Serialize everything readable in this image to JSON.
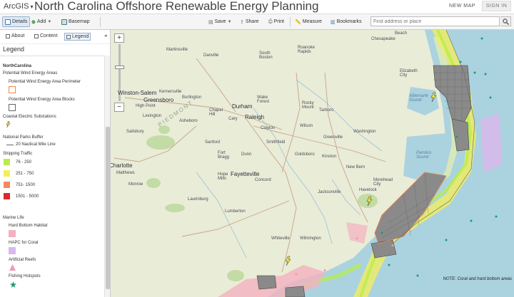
{
  "header": {
    "brand": "ArcGIS",
    "title": "North Carolina Offshore Renewable Energy Planning",
    "new_map": "NEW MAP",
    "sign_in": "SIGN IN"
  },
  "toolbar": {
    "details": "Details",
    "add": "Add",
    "basemap": "Basemap",
    "save": "Save",
    "share": "Share",
    "print": "Print",
    "measure": "Measure",
    "bookmarks": "Bookmarks",
    "search_placeholder": "Find address or place"
  },
  "sidepanel": {
    "tabs": {
      "about": "About",
      "content": "Content",
      "legend": "Legend"
    },
    "panel_title": "Legend",
    "legend": {
      "layer": "NorthCarolina",
      "wind_group": "Potential Wind Energy Areas",
      "wind_perimeter": "Potential Wind Energy Area Perimeter",
      "wind_blocks": "Potential Wind Energy Area Blocks",
      "substations": "Coastal Electric Substations",
      "parks_buffer": "National Parks Buffer",
      "buffer_line": "20 Nautical Mile Line",
      "shipping": "Shipping Traffic",
      "ship_classes": [
        "76 - 250",
        "251 - 750",
        "751- 1500",
        "1501 - 5000"
      ],
      "ship_colors": [
        "#b9ec4a",
        "#f5ef57",
        "#f28a5c",
        "#d92b2b"
      ],
      "marine_life": "Marine Life",
      "hard_bottom": "Hard Bottom Habitat",
      "hapc": "HAPC for Coral",
      "reefs": "Artificial Reefs",
      "hotspots": "Fishing Hotspots"
    }
  },
  "map": {
    "towns": {
      "virginia_beach": "Beach",
      "chesapeake": "Chesapeake",
      "elizabeth_city": "Elizabeth\nCity",
      "martinsville": "Martinsville",
      "danville": "Danville",
      "south_boston": "South\nBoston",
      "roanoke_rapids": "Roanoke\nRapids",
      "winston_salem": "Winston-Salem",
      "greensboro": "Greensboro",
      "kernersville": "Kernersville",
      "burlington": "Burlington",
      "high_point": "High Point",
      "chapel_hill": "Chapel\nHill",
      "durham": "Durham",
      "wake_forest": "Wake\nForest",
      "raleigh": "Raleigh",
      "cary": "Cary",
      "rocky_mount": "Rocky\nMount",
      "tarboro": "Tarboro",
      "wilson": "Wilson",
      "greenville": "Greenville",
      "washington": "Washington",
      "smithfield": "Smithfield",
      "goldsboro": "Goldsboro",
      "kinston": "Kinston",
      "new_bern": "New Bern",
      "jacksonville": "Jacksonville",
      "morehead": "Morehead\nCity",
      "havelock": "Havelock",
      "fayetteville": "Fayetteville",
      "sanford": "Sanford",
      "dunn": "Dunn",
      "lumberton": "Lumberton",
      "laurinburg": "Laurinburg",
      "whiteville": "Whiteville",
      "wilmington": "Wilmington",
      "charlotte": "Charlotte",
      "matthews": "Matthews",
      "monroe": "Monroe",
      "concord": "Concord",
      "asheboro": "Asheboro",
      "salisbury": "Salisbury",
      "lexington": "Lexington",
      "clayton": "Clayton",
      "fort_bragg": "Fort\nBragg",
      "hope_mills": "Hope\nMills"
    },
    "region_piedmont": "PIEDMONT",
    "albemarle": "Albemarle\nSound",
    "pamlico": "Pamlico\nSound",
    "note": "NOTE: Coral and hard bottom areas"
  }
}
